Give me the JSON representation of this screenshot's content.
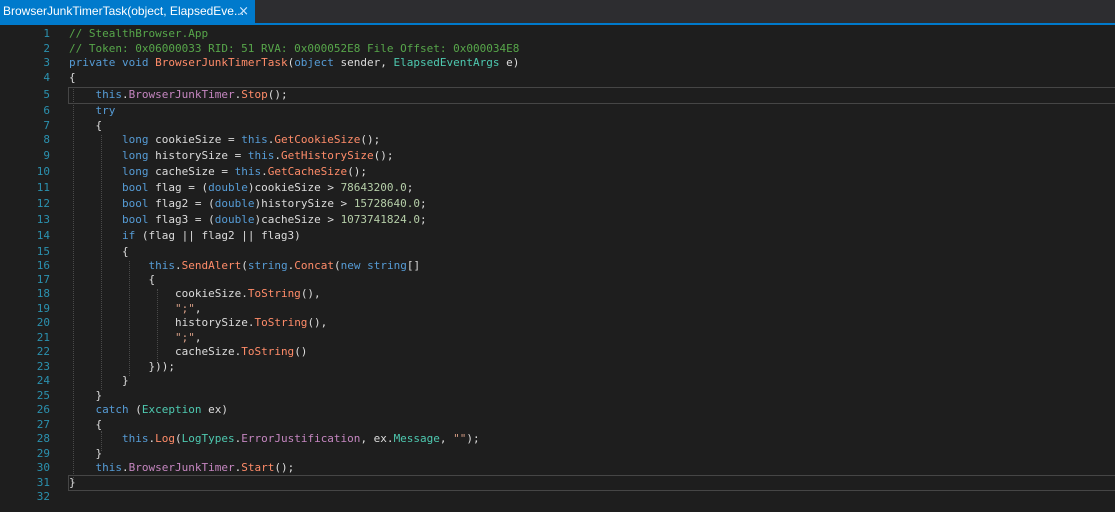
{
  "tab": {
    "title": "BrowserJunkTimerTask(object, ElapsedEve...",
    "close": "×"
  },
  "line_numbers": [
    "1",
    "2",
    "3",
    "4",
    "5",
    "6",
    "7",
    "8",
    "9",
    "10",
    "11",
    "12",
    "13",
    "14",
    "15",
    "16",
    "17",
    "18",
    "19",
    "20",
    "21",
    "22",
    "23",
    "24",
    "25",
    "26",
    "27",
    "28",
    "29",
    "30",
    "31",
    "32"
  ],
  "code": {
    "l1": "// StealthBrowser.App",
    "l2": "// Token: 0x06000033 RID: 51 RVA: 0x000052E8 File Offset: 0x000034E8",
    "l3": {
      "kw1": "private",
      "kw2": "void",
      "name": "BrowserJunkTimerTask",
      "p1": "(",
      "kw3": "object",
      "rest": " sender, ",
      "type": "ElapsedEventArgs",
      "end": " e)"
    },
    "l4": "{",
    "l5": {
      "kw": "this",
      "dot": ".",
      "prop": "BrowserJunkTimer",
      "dot2": ".",
      "m": "Stop",
      "end": "();"
    },
    "l6": "try",
    "l7": "{",
    "l8": {
      "kw": "long",
      "mid": " cookieSize = ",
      "kw2": "this",
      "dot": ".",
      "m": "GetCookieSize",
      "end": "();"
    },
    "l9": {
      "kw": "long",
      "mid": " historySize = ",
      "kw2": "this",
      "dot": ".",
      "m": "GetHistorySize",
      "end": "();"
    },
    "l10": {
      "kw": "long",
      "mid": " cacheSize = ",
      "kw2": "this",
      "dot": ".",
      "m": "GetCacheSize",
      "end": "();"
    },
    "l11": {
      "kw": "bool",
      "mid": " flag = (",
      "kw2": "double",
      "mid2": ")cookieSize > ",
      "num": "78643200.0",
      "end": ";"
    },
    "l12": {
      "kw": "bool",
      "mid": " flag2 = (",
      "kw2": "double",
      "mid2": ")historySize > ",
      "num": "15728640.0",
      "end": ";"
    },
    "l13": {
      "kw": "bool",
      "mid": " flag3 = (",
      "kw2": "double",
      "mid2": ")cacheSize > ",
      "num": "1073741824.0",
      "end": ";"
    },
    "l14": {
      "kw": "if",
      "rest": " (flag || flag2 || flag3)"
    },
    "l15": "{",
    "l16": {
      "kw": "this",
      "dot": ".",
      "m": "SendAlert",
      "p": "(",
      "kw2": "string",
      "dot2": ".",
      "m2": "Concat",
      "p2": "(",
      "kw3": "new",
      "sp": " ",
      "kw4": "string",
      "end": "[]"
    },
    "l17": "{",
    "l18": {
      "a": "cookieSize.",
      "m": "ToString",
      "end": "(),"
    },
    "l19": {
      "s": "\";\"",
      "end": ","
    },
    "l20": {
      "a": "historySize.",
      "m": "ToString",
      "end": "(),"
    },
    "l21": {
      "s": "\";\"",
      "end": ","
    },
    "l22": {
      "a": "cacheSize.",
      "m": "ToString",
      "end": "()"
    },
    "l23": "}));",
    "l24": "}",
    "l25": "}",
    "l26": {
      "kw": "catch",
      "p": " (",
      "type": "Exception",
      "end": " ex)"
    },
    "l27": "{",
    "l28": {
      "kw": "this",
      "dot": ".",
      "m": "Log",
      "p": "(",
      "type": "LogTypes",
      "dot2": ".",
      "prop": "ErrorJustification",
      "mid": ", ex.",
      "prop2": "Message",
      "mid2": ", ",
      "s": "\"\"",
      "end": ");"
    },
    "l29": "}",
    "l30": {
      "kw": "this",
      "dot": ".",
      "prop": "BrowserJunkTimer",
      "dot2": ".",
      "m": "Start",
      "end": "();"
    },
    "l31": "}",
    "l32": ""
  }
}
